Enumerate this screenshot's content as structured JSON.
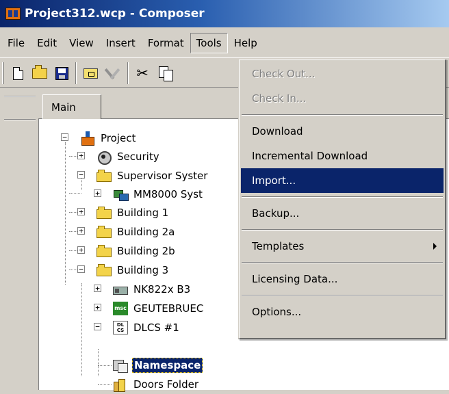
{
  "window": {
    "title": "Project312.wcp - Composer"
  },
  "menubar": {
    "items": [
      "File",
      "Edit",
      "View",
      "Insert",
      "Format",
      "Tools",
      "Help"
    ],
    "open": "Tools"
  },
  "toolbar": {
    "buttons": [
      "new-document-icon",
      "open-folder-icon",
      "save-disk-icon",
      "properties-icon",
      "tools-icon",
      "cut-scissors-icon",
      "copy-icon"
    ]
  },
  "tabs": {
    "main": "Main"
  },
  "tree": {
    "project": "Project",
    "security": "Security",
    "supervisor": "Supervisor Syster",
    "mm8000": "MM8000 Syst",
    "building1": "Building 1",
    "building2a": "Building 2a",
    "building2b": "Building 2b",
    "building3": "Building 3",
    "nk822x": "NK822x B3",
    "geutebrueck": "GEUTEBRUEC",
    "dlcs": "DLCS #1",
    "namespace": "Namespace",
    "doors": "Doors Folder",
    "msc_badge": "msc",
    "dlcs_badge_1": "DL",
    "dlcs_badge_2": "CS",
    "selected": "Namespace"
  },
  "tools_menu": {
    "check_out": "Check Out...",
    "check_in": "Check In...",
    "download": "Download",
    "incremental_download": "Incremental Download",
    "import": "Import...",
    "backup": "Backup...",
    "templates": "Templates",
    "licensing": "Licensing Data...",
    "options": "Options...",
    "highlighted": "Import..."
  },
  "colors": {
    "titlebar_start": "#0a246a",
    "titlebar_end": "#a6caf0",
    "highlight": "#0a246a",
    "face": "#d4d0c8"
  }
}
